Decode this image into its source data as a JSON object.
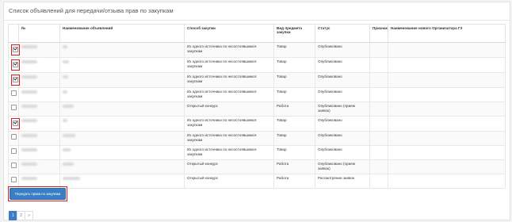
{
  "panel": {
    "title": "Список объявлений для передачи/отзыва прав по закупкам"
  },
  "table": {
    "headers": [
      "",
      "№",
      "Наименование объявлений",
      "Способ закупки",
      "Вид предмета закупки",
      "Статус",
      "Признак",
      "Наименование нового Организатора ГЗ"
    ],
    "rows": [
      {
        "checked": true,
        "highlight": true,
        "method": "Из одного источника по несостоявшимся закупкам",
        "subject": "Товар",
        "status": "Опубликовано"
      },
      {
        "checked": true,
        "highlight": true,
        "method": "Из одного источника по несостоявшимся закупкам",
        "subject": "Товар",
        "status": "Опубликовано"
      },
      {
        "checked": true,
        "highlight": true,
        "method": "Из одного источника по несостоявшимся закупкам",
        "subject": "Товар",
        "status": "Опубликовано"
      },
      {
        "checked": false,
        "highlight": false,
        "method": "Из одного источника по несостоявшимся закупкам",
        "subject": "Товар",
        "status": "Опубликовано"
      },
      {
        "checked": false,
        "highlight": false,
        "method": "Открытый конкурс",
        "subject": "Работа",
        "status": "Опубликовано (прием заявок)"
      },
      {
        "checked": true,
        "highlight": true,
        "method": "Из одного источника по несостоявшимся закупкам",
        "subject": "Товар",
        "status": "Опубликовано"
      },
      {
        "checked": false,
        "highlight": false,
        "method": "Из одного источника по несостоявшимся закупкам",
        "subject": "Товар",
        "status": "Опубликовано"
      },
      {
        "checked": false,
        "highlight": false,
        "method": "Из одного источника по несостоявшимся закупкам",
        "subject": "Товар",
        "status": "Опубликовано"
      },
      {
        "checked": false,
        "highlight": false,
        "method": "Открытый конкурс",
        "subject": "Работа",
        "status": "Опубликовано (прием заявок)"
      },
      {
        "checked": false,
        "highlight": false,
        "method": "Открытый конкурс",
        "subject": "Работа",
        "status": "Рассмотрение заявок"
      }
    ]
  },
  "actions": {
    "transfer_button": "Передать права по закупкам"
  },
  "pagination": {
    "pages": [
      "1",
      "2",
      "»"
    ],
    "active": "1"
  },
  "colors": {
    "accent": "#3a7fc4",
    "highlight_border": "#d32020"
  }
}
